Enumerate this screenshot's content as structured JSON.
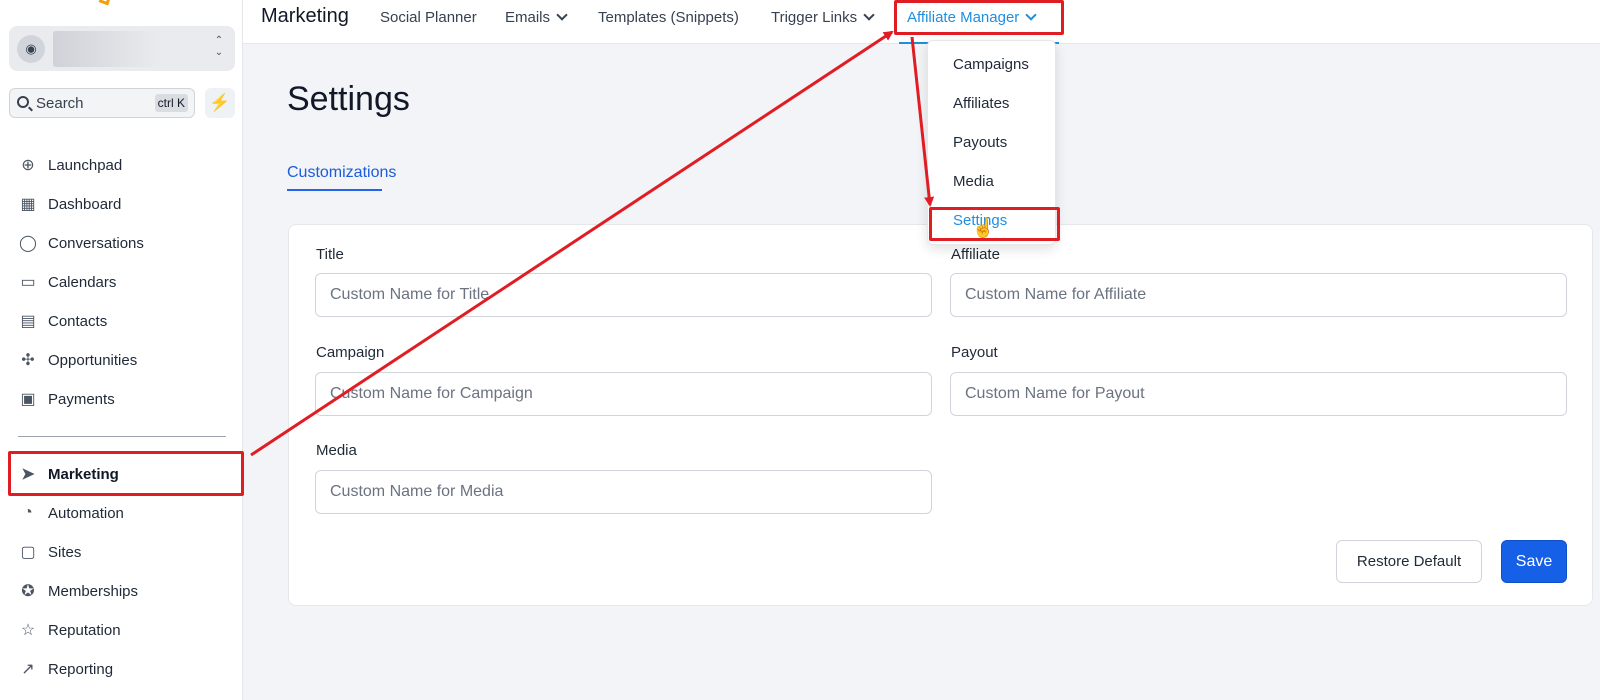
{
  "sidebar": {
    "search_label": "Search",
    "search_shortcut": "ctrl K",
    "items": [
      {
        "label": "Launchpad",
        "icon": "launchpad-icon"
      },
      {
        "label": "Dashboard",
        "icon": "dashboard-icon"
      },
      {
        "label": "Conversations",
        "icon": "chat-icon"
      },
      {
        "label": "Calendars",
        "icon": "calendar-icon"
      },
      {
        "label": "Contacts",
        "icon": "contacts-icon"
      },
      {
        "label": "Opportunities",
        "icon": "opportunities-icon"
      },
      {
        "label": "Payments",
        "icon": "payments-icon"
      },
      {
        "label": "Marketing",
        "icon": "send-icon",
        "active": true
      },
      {
        "label": "Automation",
        "icon": "automation-icon"
      },
      {
        "label": "Sites",
        "icon": "sites-icon"
      },
      {
        "label": "Memberships",
        "icon": "memberships-icon"
      },
      {
        "label": "Reputation",
        "icon": "star-icon"
      },
      {
        "label": "Reporting",
        "icon": "trend-icon"
      }
    ]
  },
  "header": {
    "title": "Marketing",
    "nav": [
      {
        "label": "Social Planner"
      },
      {
        "label": "Emails"
      },
      {
        "label": "Templates (Snippets)"
      },
      {
        "label": "Trigger Links"
      },
      {
        "label": "Affiliate Manager"
      }
    ]
  },
  "affiliate_menu": {
    "items": [
      "Campaigns",
      "Affiliates",
      "Payouts",
      "Media",
      "Settings"
    ],
    "selected": "Settings"
  },
  "main": {
    "title": "Settings",
    "tab": "Customizations",
    "fields": {
      "title": {
        "label": "Title",
        "placeholder": "Custom Name for Title"
      },
      "affiliate": {
        "label": "Affiliate",
        "placeholder": "Custom Name for Affiliate"
      },
      "campaign": {
        "label": "Campaign",
        "placeholder": "Custom Name for Campaign"
      },
      "payout": {
        "label": "Payout",
        "placeholder": "Custom Name for Payout"
      },
      "media": {
        "label": "Media",
        "placeholder": "Custom Name for Media"
      }
    },
    "restore_label": "Restore Default",
    "save_label": "Save"
  },
  "colors": {
    "accent": "#1d8fe1",
    "primary_button": "#1660e8",
    "annotation": "#e11d24"
  }
}
